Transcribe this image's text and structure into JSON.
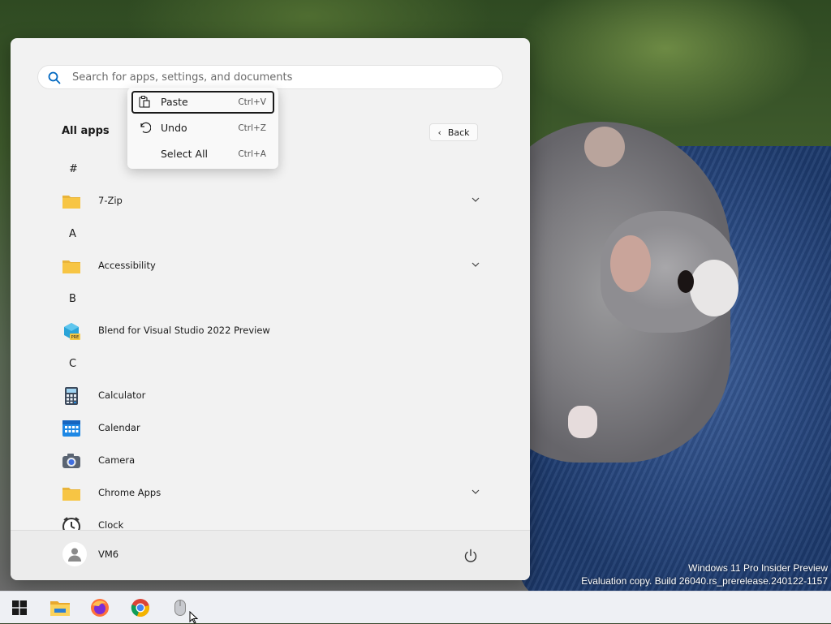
{
  "search": {
    "placeholder": "Search for apps, settings, and documents"
  },
  "all_apps": {
    "title": "All apps",
    "back_label": "Back"
  },
  "context_menu": {
    "items": [
      {
        "label": "Paste",
        "shortcut": "Ctrl+V",
        "icon": "clipboard-icon",
        "focused": true
      },
      {
        "label": "Undo",
        "shortcut": "Ctrl+Z",
        "icon": "undo-icon"
      },
      {
        "label": "Select All",
        "shortcut": "Ctrl+A",
        "icon": ""
      }
    ]
  },
  "app_list": {
    "headers": [
      "#",
      "A",
      "B",
      "C"
    ],
    "apps": [
      {
        "label": "7-Zip",
        "icon": "folder-icon",
        "expandable": true
      },
      {
        "label": "Accessibility",
        "icon": "folder-icon",
        "expandable": true
      },
      {
        "label": "Blend for Visual Studio 2022 Preview",
        "icon": "blend-icon",
        "expandable": false
      },
      {
        "label": "Calculator",
        "icon": "calculator-icon",
        "expandable": false
      },
      {
        "label": "Calendar",
        "icon": "calendar-icon",
        "expandable": false
      },
      {
        "label": "Camera",
        "icon": "camera-icon",
        "expandable": false
      },
      {
        "label": "Chrome Apps",
        "icon": "folder-icon",
        "expandable": true
      },
      {
        "label": "Clock",
        "icon": "clock-icon",
        "expandable": false
      }
    ]
  },
  "user": {
    "name": "VM6"
  },
  "watermark": {
    "line1": "Windows 11 Pro Insider Preview",
    "line2": "Evaluation copy. Build 26040.rs_prerelease.240122-1157"
  },
  "taskbar": {
    "items": [
      "start-icon",
      "file-explorer-icon",
      "firefox-icon",
      "chrome-icon",
      "mouse-icon"
    ]
  },
  "colors": {
    "accent_blue": "#0067c0",
    "folder_yellow": "#f7c544",
    "menu_background": "#f2f2f2"
  }
}
